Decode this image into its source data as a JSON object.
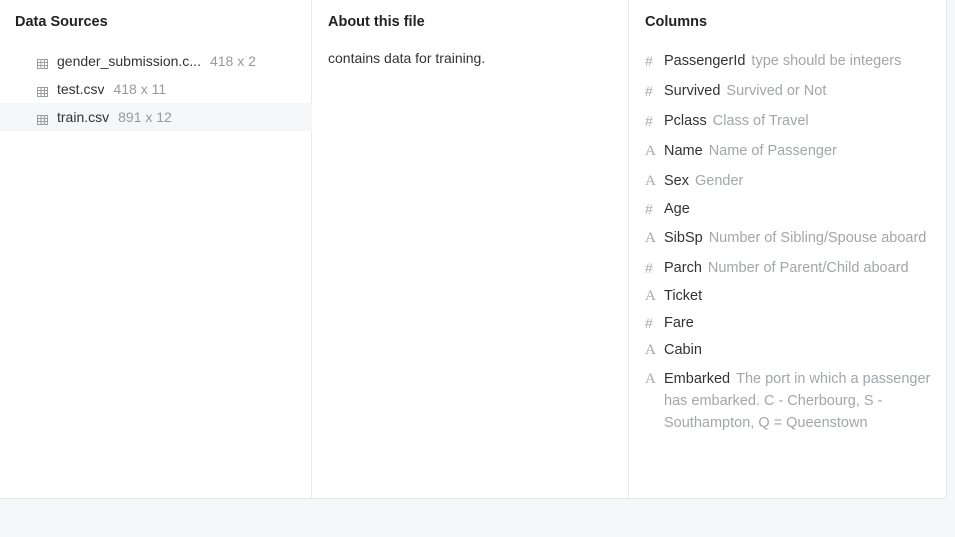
{
  "sources": {
    "title": "Data Sources",
    "files": [
      {
        "name": "gender_submission.c...",
        "dims": "418 x 2",
        "selected": false
      },
      {
        "name": "test.csv",
        "dims": "418 x 11",
        "selected": false
      },
      {
        "name": "train.csv",
        "dims": "891 x 12",
        "selected": true
      }
    ]
  },
  "about": {
    "title": "About this file",
    "text": "contains data for training."
  },
  "columns": {
    "title": "Columns",
    "items": [
      {
        "type_icon": "#",
        "type": "numeric",
        "name": "PassengerId",
        "desc": "type should be integers"
      },
      {
        "type_icon": "#",
        "type": "numeric",
        "name": "Survived",
        "desc": "Survived or Not"
      },
      {
        "type_icon": "#",
        "type": "numeric",
        "name": "Pclass",
        "desc": "Class of Travel"
      },
      {
        "type_icon": "A",
        "type": "text",
        "name": "Name",
        "desc": "Name of Passenger"
      },
      {
        "type_icon": "A",
        "type": "text",
        "name": "Sex",
        "desc": "Gender"
      },
      {
        "type_icon": "#",
        "type": "numeric",
        "name": "Age",
        "desc": ""
      },
      {
        "type_icon": "A",
        "type": "text",
        "name": "SibSp",
        "desc": "Number of Sibling/Spouse aboard"
      },
      {
        "type_icon": "#",
        "type": "numeric",
        "name": "Parch",
        "desc": "Number of Parent/Child aboard"
      },
      {
        "type_icon": "A",
        "type": "text",
        "name": "Ticket",
        "desc": ""
      },
      {
        "type_icon": "#",
        "type": "numeric",
        "name": "Fare",
        "desc": ""
      },
      {
        "type_icon": "A",
        "type": "text",
        "name": "Cabin",
        "desc": ""
      },
      {
        "type_icon": "A",
        "type": "text",
        "name": "Embarked",
        "desc": "The port in which a passenger has embarked. C - Cherbourg, S - Southampton, Q = Queenstown"
      }
    ]
  }
}
